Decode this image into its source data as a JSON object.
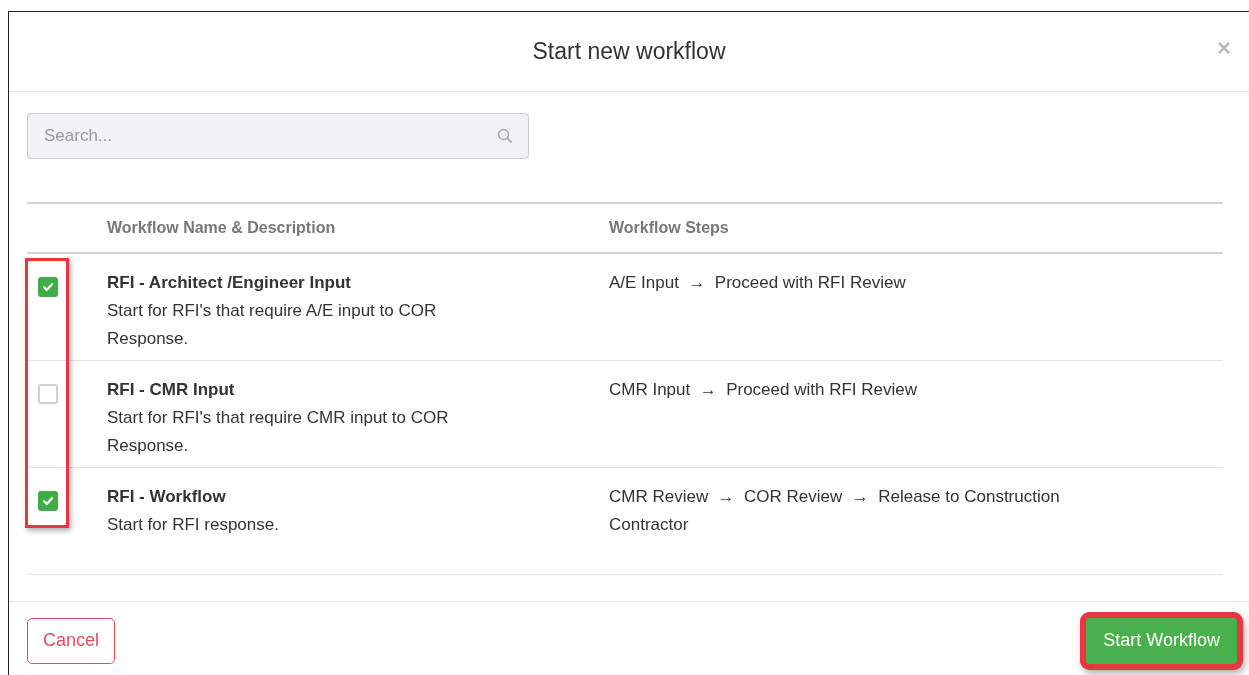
{
  "dialog": {
    "title": "Start new workflow",
    "close": "×"
  },
  "search": {
    "placeholder": "Search..."
  },
  "table": {
    "columns": [
      "Workflow Name & Description",
      "Workflow Steps"
    ],
    "checkbox_column_highlighted": true,
    "rows": [
      {
        "name": "RFI - Architect /Engineer Input",
        "description": "Start for RFI's that require A/E input to COR Response.",
        "steps": "A/E Input  →  Proceed with RFI Review",
        "checked": true
      },
      {
        "name": "RFI - CMR Input",
        "description": "Start for RFI's that require CMR input to COR Response.",
        "steps": "CMR Input  →  Proceed with RFI Review",
        "checked": false
      },
      {
        "name": "RFI - Workflow",
        "description": "Start for RFI response.",
        "steps": "CMR Review  →  COR Review  →  Release to Construction Contractor",
        "checked": true
      }
    ]
  },
  "footer": {
    "cancel": "Cancel",
    "start": {
      "label": "Start Workflow",
      "highlighted": true
    }
  }
}
